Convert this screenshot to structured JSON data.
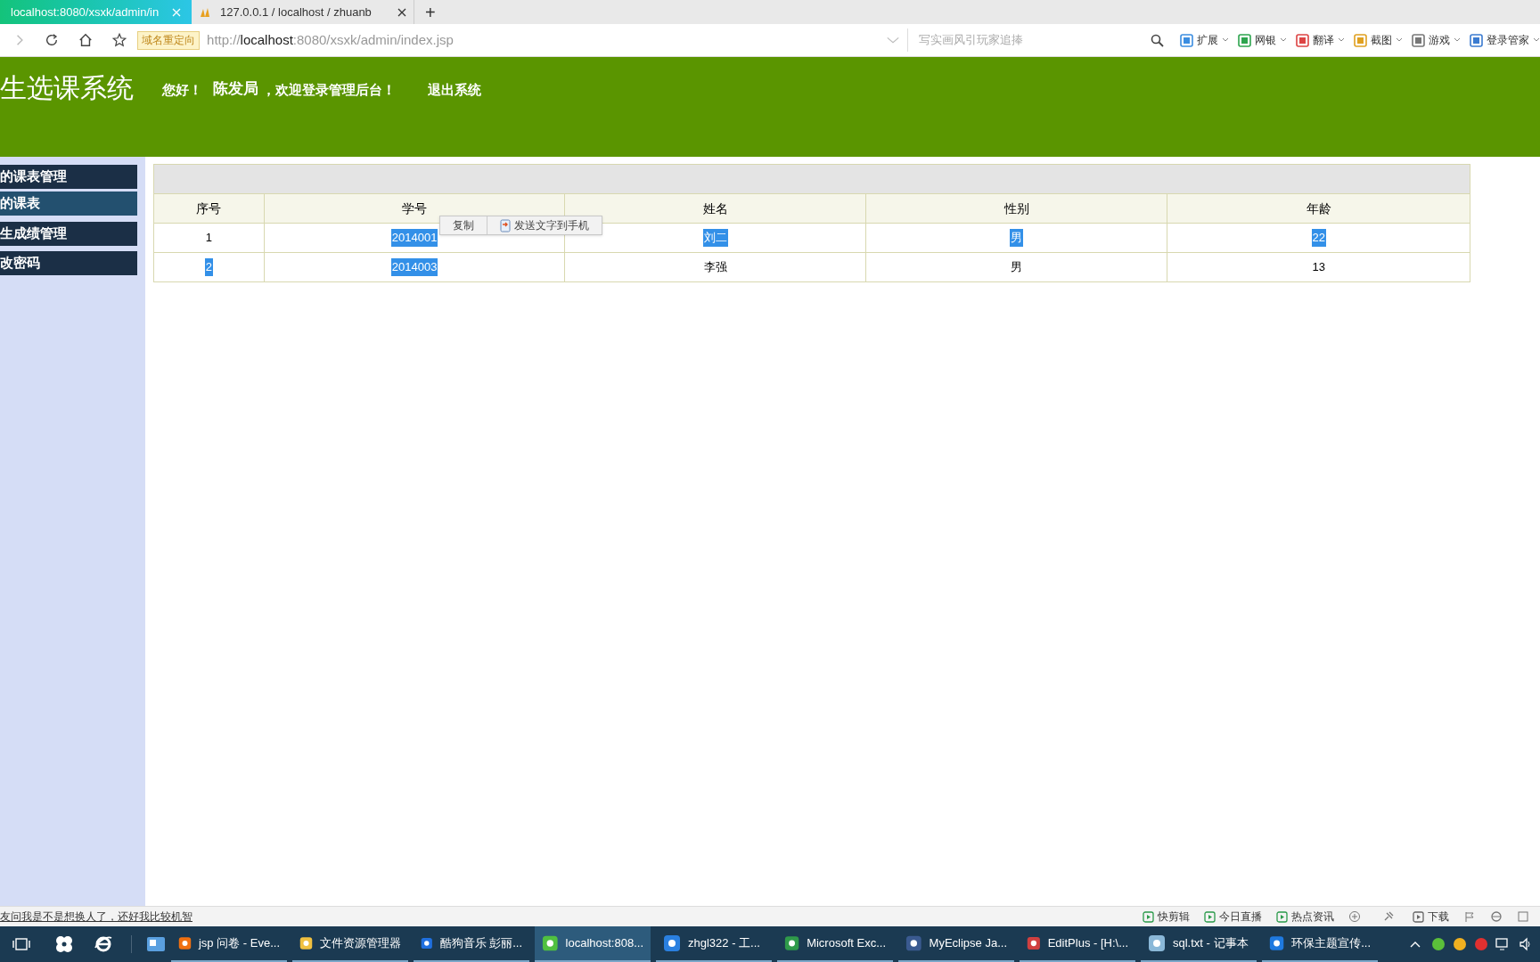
{
  "browser": {
    "tabs": [
      {
        "title": "localhost:8080/xsxk/admin/in",
        "selected": true
      },
      {
        "title": "127.0.0.1 / localhost / zhuanb",
        "selected": false
      }
    ],
    "new_tab": "+",
    "redirect_badge": "域名重定向",
    "url": {
      "scheme": "http://",
      "host": "localhost",
      "rest": ":8080/xsxk/admin/index.jsp"
    },
    "search": {
      "placeholder": "写实画风引玩家追捧"
    },
    "toolbar": [
      "扩展",
      "网银",
      "翻译",
      "截图",
      "游戏",
      "登录管家"
    ]
  },
  "header": {
    "title": "生选课系统",
    "greeting": "您好！",
    "user": "陈发局",
    "welcome": "，欢迎登录管理后台！",
    "logout": "退出系统"
  },
  "sidebar": {
    "items": [
      {
        "label": "的课表管理",
        "selected": false
      },
      {
        "label": "的课表",
        "selected": true
      },
      {
        "label": "生成绩管理",
        "selected": false
      },
      {
        "label": "改密码",
        "selected": false
      }
    ]
  },
  "table": {
    "columns": [
      "序号",
      "学号",
      "姓名",
      "性别",
      "年龄"
    ],
    "rows": [
      [
        {
          "text": "1",
          "highlighted": false
        },
        {
          "text": "2014001",
          "highlighted": true
        },
        {
          "text": "刘二",
          "highlighted": true
        },
        {
          "text": "男",
          "highlighted": true
        },
        {
          "text": "22",
          "highlighted": true
        }
      ],
      [
        {
          "text": "2",
          "highlighted": true
        },
        {
          "text": "2014003",
          "highlighted": true
        },
        {
          "text": "李强",
          "highlighted": false
        },
        {
          "text": "男",
          "highlighted": false
        },
        {
          "text": "13",
          "highlighted": false
        }
      ]
    ]
  },
  "context_menu": {
    "items": [
      "复制",
      "发送文字到手机"
    ]
  },
  "status_bar": {
    "message": "友问我是不是想换人了，还好我比较机智",
    "items": [
      "快剪辑",
      "今日直播",
      "热点资讯",
      "下载"
    ]
  },
  "taskbar": {
    "items": [
      {
        "label": "jsp 问卷 - Eve...",
        "selected": false
      },
      {
        "label": "文件资源管理器",
        "selected": false
      },
      {
        "label": "酷狗音乐 彭丽...",
        "selected": false
      },
      {
        "label": "localhost:808...",
        "selected": true
      },
      {
        "label": "zhgl322 - 工...",
        "selected": false
      },
      {
        "label": "Microsoft Exc...",
        "selected": false
      },
      {
        "label": "MyEclipse Ja...",
        "selected": false
      },
      {
        "label": "EditPlus - [H:\\...",
        "selected": false
      },
      {
        "label": "sql.txt - 记事本",
        "selected": false
      },
      {
        "label": "环保主题宣传...",
        "selected": false
      }
    ]
  }
}
